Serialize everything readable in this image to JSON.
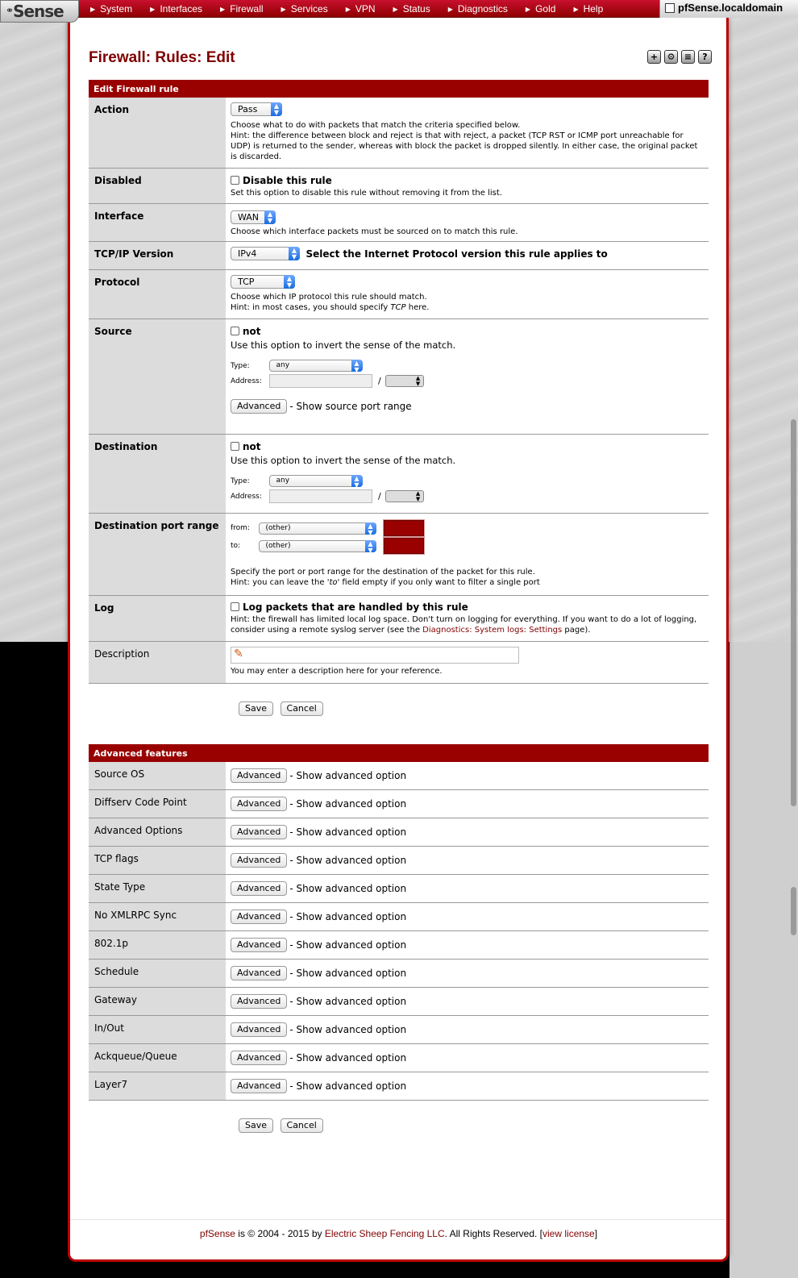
{
  "nav": {
    "logo": "Sense",
    "items": [
      "System",
      "Interfaces",
      "Firewall",
      "Services",
      "VPN",
      "Status",
      "Diagnostics",
      "Gold",
      "Help"
    ],
    "hostname": "pfSense.localdomain"
  },
  "page": {
    "title": "Firewall: Rules: Edit",
    "icons": [
      "add-icon",
      "settings-icon",
      "log-icon",
      "help-icon"
    ]
  },
  "edit": {
    "header": "Edit Firewall rule",
    "action": {
      "label": "Action",
      "value": "Pass",
      "hint1": "Choose what to do with packets that match the criteria specified below.",
      "hint2": "Hint: the difference between block and reject is that with reject, a packet (TCP RST or ICMP port unreachable for UDP) is returned to the sender, whereas with block the packet is dropped silently. In either case, the original packet is discarded."
    },
    "disabled": {
      "label": "Disabled",
      "checkbox": "Disable this rule",
      "hint": "Set this option to disable this rule without removing it from the list."
    },
    "interface": {
      "label": "Interface",
      "value": "WAN",
      "hint": "Choose which interface packets must be sourced on to match this rule."
    },
    "ipver": {
      "label": "TCP/IP Version",
      "value": "IPv4",
      "text": "Select the Internet Protocol version this rule applies to"
    },
    "protocol": {
      "label": "Protocol",
      "value": "TCP",
      "hint1": "Choose which IP protocol this rule should match.",
      "hint2_pre": "Hint: in most cases, you should specify ",
      "hint2_em": "TCP",
      "hint2_post": "  here."
    },
    "source": {
      "label": "Source",
      "not": "not",
      "hint": "Use this option to invert the sense of the match.",
      "type_label": "Type:",
      "type_value": "any",
      "address_label": "Address:",
      "slash": "/",
      "adv_button": "Advanced",
      "adv_text": "- Show source port range"
    },
    "destination": {
      "label": "Destination",
      "not": "not",
      "hint": "Use this option to invert the sense of the match.",
      "type_label": "Type:",
      "type_value": "any",
      "address_label": "Address:",
      "slash": "/"
    },
    "dport": {
      "label": "Destination port range",
      "from_label": "from:",
      "from_value": "(other)",
      "to_label": "to:",
      "to_value": "(other)",
      "hint1": "Specify the port or port range for the destination of the packet for this rule.",
      "hint2_pre": "Hint: you can leave the ",
      "hint2_em": "'to'",
      "hint2_post": " field empty if you only want to filter a single port"
    },
    "log": {
      "label": "Log",
      "checkbox": "Log packets that are handled by this rule",
      "hint_pre": "Hint: the firewall has limited local log space. Don't turn on logging for everything. If you want to do a lot of logging, consider using a remote syslog server (see the ",
      "hint_link": "Diagnostics: System logs: Settings",
      "hint_post": " page)."
    },
    "description": {
      "label": "Description",
      "value": "",
      "hint": "You may enter a description here for your reference."
    },
    "save": "Save",
    "cancel": "Cancel"
  },
  "advanced": {
    "header": "Advanced features",
    "button": "Advanced",
    "text": "- Show advanced option",
    "rows": [
      "Source OS",
      "Diffserv Code Point",
      "Advanced Options",
      "TCP flags",
      "State Type",
      "No XMLRPC Sync",
      "802.1p",
      "Schedule",
      "Gateway",
      "In/Out",
      "Ackqueue/Queue",
      "Layer7"
    ],
    "save": "Save",
    "cancel": "Cancel"
  },
  "footer": {
    "brand": "pfSense",
    "mid": " is © 2004 - 2015 by ",
    "company": "Electric Sheep Fencing LLC",
    "rights": ". All Rights Reserved. [",
    "license": "view license",
    "close": "]"
  },
  "colors": {
    "accent": "#990000",
    "title": "#800000",
    "label_bg": "#dcdcdc"
  }
}
